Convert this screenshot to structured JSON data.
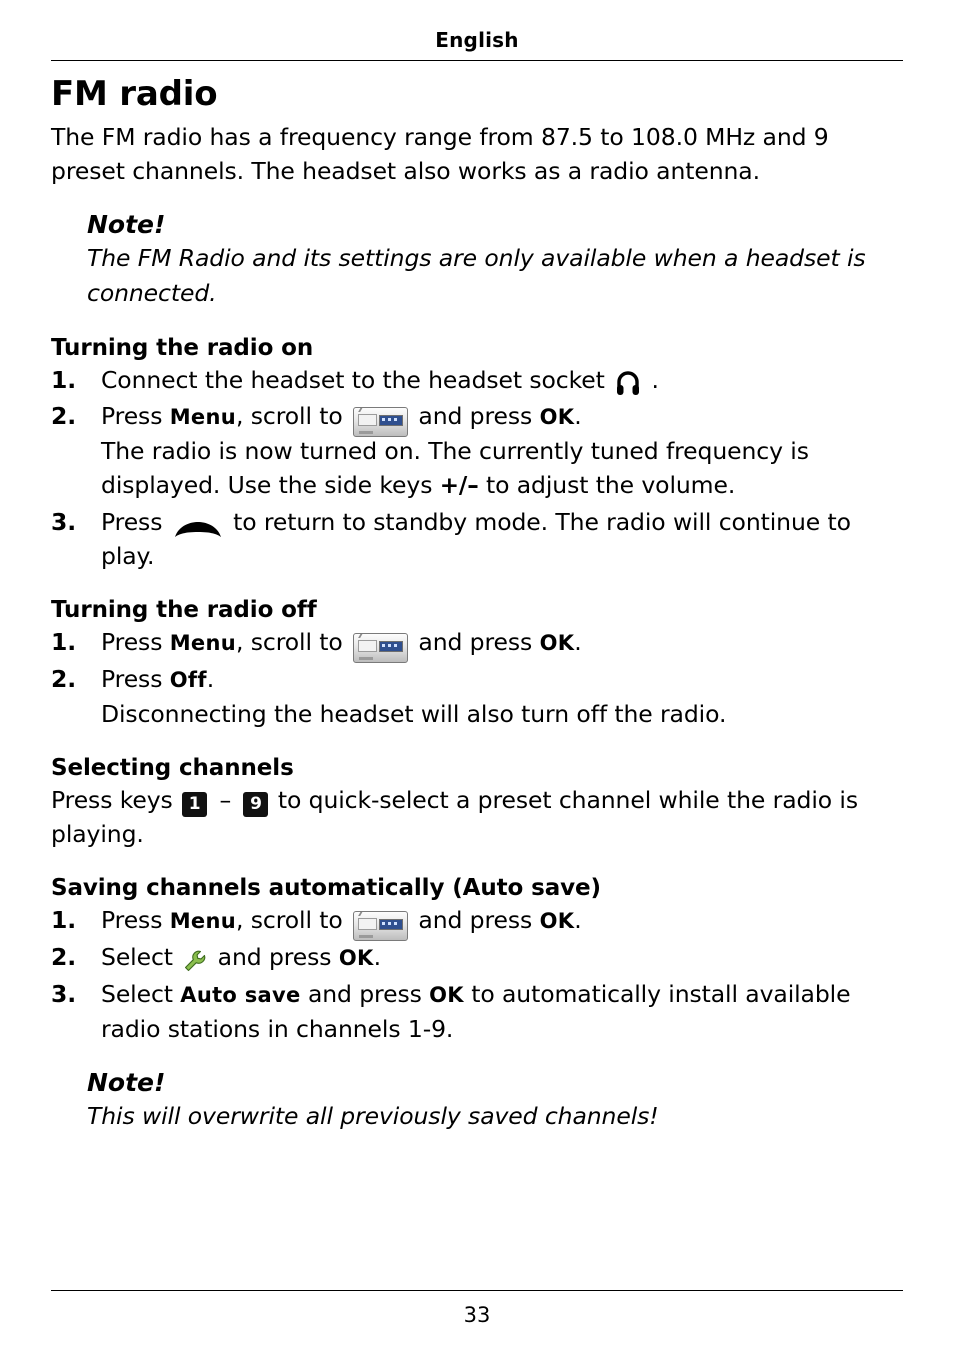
{
  "header": {
    "language": "English"
  },
  "footer": {
    "page_number": "33"
  },
  "document": {
    "title": "FM radio",
    "intro": "The FM radio has a frequency range from 87.5 to 108.0 MHz and 9 preset channels. The headset also works as a radio antenna.",
    "note1": {
      "label": "Note!",
      "text": "The FM Radio and its settings are only available when a headset is connected."
    },
    "sections": [
      {
        "heading": "Turning the radio on",
        "steps": [
          {
            "num": "1.",
            "pre": "Connect the headset to the headset socket",
            "icon": "headset-socket-icon",
            "post": "."
          },
          {
            "num": "2.",
            "a": "Press",
            "key1": "Menu",
            "b": ", scroll to",
            "icon": "fm-radio-icon",
            "c": "and press",
            "key2": "OK",
            "d": ".",
            "line2": "The radio is now turned on. The currently tuned frequency is displayed. Use the side keys",
            "sidekeys": "+/–",
            "line2b": "to adjust the volume."
          },
          {
            "num": "3.",
            "a": "Press",
            "icon": "hang-up-icon",
            "b": "to return to standby mode. The radio will continue to play."
          }
        ]
      },
      {
        "heading": "Turning the radio off",
        "steps": [
          {
            "num": "1.",
            "a": "Press",
            "key1": "Menu",
            "b": ", scroll to",
            "icon": "fm-radio-icon",
            "c": "and press",
            "key2": "OK",
            "d": "."
          },
          {
            "num": "2.",
            "a": "Press",
            "key1": "Off",
            "b": ".",
            "line2": "Disconnecting the headset will also turn off the radio."
          }
        ]
      },
      {
        "heading": "Selecting channels",
        "text_a": "Press keys",
        "key_low": "1",
        "dash": "–",
        "key_high": "9",
        "text_b": "to quick-select a preset channel while the radio is playing."
      },
      {
        "heading": "Saving channels automatically (Auto save)",
        "steps": [
          {
            "num": "1.",
            "a": "Press",
            "key1": "Menu",
            "b": ", scroll to",
            "icon": "fm-radio-icon",
            "c": "and press",
            "key2": "OK",
            "d": "."
          },
          {
            "num": "2.",
            "a": "Select",
            "icon": "settings-wrench-icon",
            "b": "and press",
            "key2": "OK",
            "d": "."
          },
          {
            "num": "3.",
            "a": "Select",
            "key1": "Auto save",
            "b": "and press",
            "key2": "OK",
            "c": "to automatically install available radio stations in channels 1-9."
          }
        ]
      }
    ],
    "note2": {
      "label": "Note!",
      "text": "This will overwrite all previously saved channels!"
    }
  }
}
